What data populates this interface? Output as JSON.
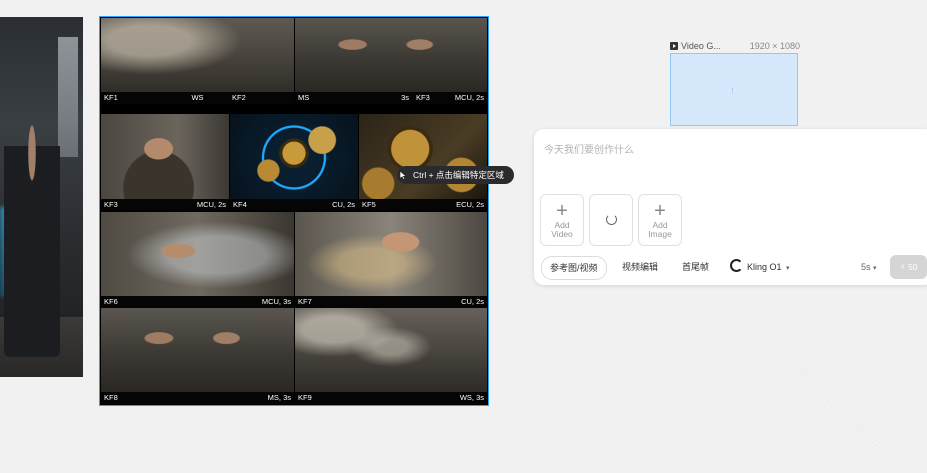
{
  "storyboard": {
    "panels": [
      {
        "id": "KF1",
        "shot": "WS",
        "duration": "3s"
      },
      {
        "id": "KF2",
        "shot": "MS",
        "duration": "3s"
      },
      {
        "id": "KF3",
        "shot": "MCU, 2s",
        "duration": ""
      },
      {
        "id": "KF3",
        "shot": "MCU, 2s",
        "duration": ""
      },
      {
        "id": "KF4",
        "shot": "CU, 2s",
        "duration": ""
      },
      {
        "id": "KF5",
        "shot": "ECU, 2s",
        "duration": ""
      },
      {
        "id": "KF6",
        "shot": "MCU, 3s",
        "duration": ""
      },
      {
        "id": "KF7",
        "shot": "CU, 2s",
        "duration": ""
      },
      {
        "id": "KF8",
        "shot": "MS, 3s",
        "duration": ""
      },
      {
        "id": "KF9",
        "shot": "WS, 3s",
        "duration": ""
      }
    ]
  },
  "tooltip": {
    "text": "Ctrl + 点击编辑特定区域"
  },
  "video_node": {
    "title": "Video G...",
    "resolution": "1920 × 1080"
  },
  "composer": {
    "placeholder": "今天我们要创作什么",
    "add_video": [
      "Add",
      "Video"
    ],
    "add_image": [
      "Add",
      "Image"
    ],
    "tabs": {
      "reference": "参考图/视频",
      "video_edit": "视频编辑",
      "first_last_frame": "首尾帧"
    },
    "model": "Kling O1",
    "duration": "5s",
    "send_credits": "50"
  },
  "watermark": "高效AI工具站"
}
